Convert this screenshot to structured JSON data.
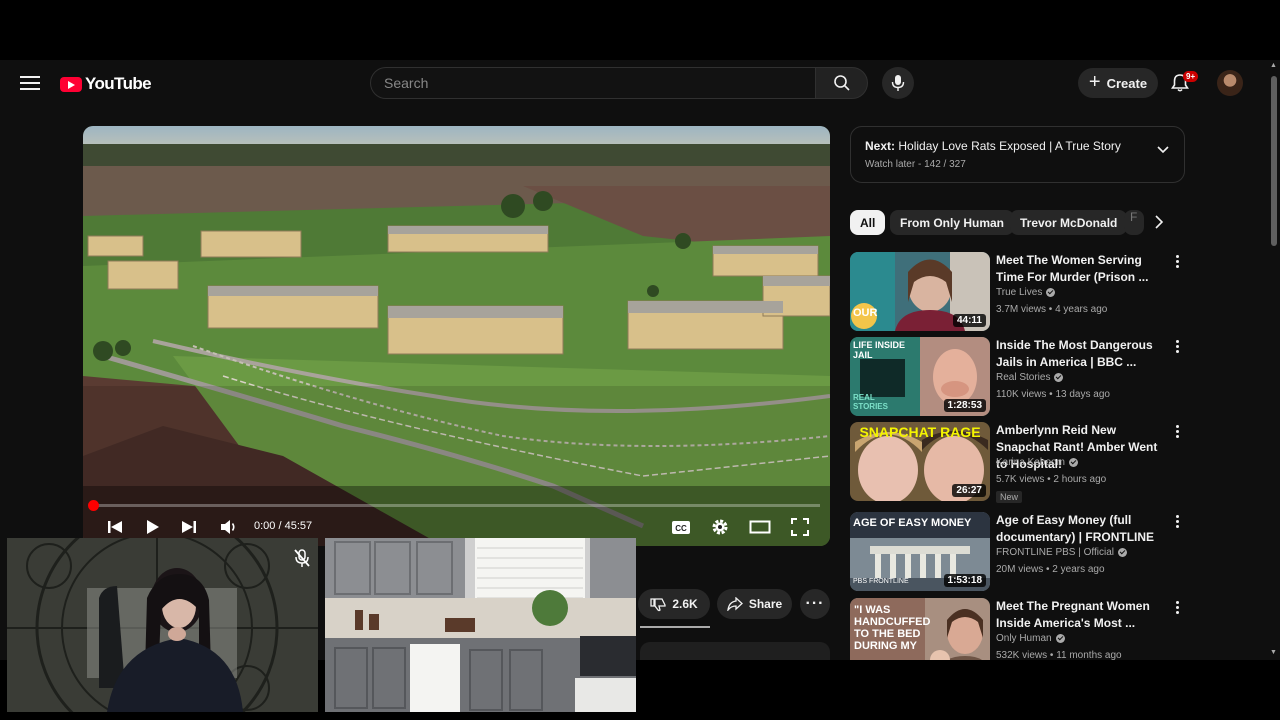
{
  "header": {
    "logo_text": "YouTube",
    "search_placeholder": "Search",
    "create_label": "Create",
    "notification_count": "9+"
  },
  "player": {
    "time_display": "0:00 / 45:57",
    "progress_fraction": 0.0
  },
  "up_next": {
    "prefix": "Next:",
    "title": "Holiday Love Rats Exposed | A True Story",
    "playlist": "Watch later - 142 / 327"
  },
  "chips": [
    "All",
    "From Only Human",
    "Trevor McDonald",
    "F"
  ],
  "recommendations": [
    {
      "title": "Meet The Women Serving Time For Murder (Prison ...",
      "channel": "True Lives",
      "verified": true,
      "meta": "3.7M views • 4 years ago",
      "duration": "44:11",
      "thumb_text": "OUR"
    },
    {
      "title": "Inside The Most Dangerous Jails in America | BBC ...",
      "channel": "Real Stories",
      "verified": true,
      "meta": "110K views • 13 days ago",
      "duration": "1:28:53",
      "thumb_text": "LIFE INSIDE JAIL",
      "thumb_text2": "REAL STORIES"
    },
    {
      "title": "Amberlynn Reid New Snapchat Rant! Amber Went to Hospital!",
      "channel": "Karina Kaboom",
      "verified": true,
      "meta": "5.7K views • 2 hours ago",
      "badge": "New",
      "duration": "26:27",
      "thumb_text": "SNAPCHAT RAGE"
    },
    {
      "title": "Age of Easy Money (full documentary) | FRONTLINE",
      "channel": "FRONTLINE PBS | Official",
      "verified": true,
      "meta": "20M views • 2 years ago",
      "duration": "1:53:18",
      "thumb_text": "AGE OF EASY MONEY",
      "thumb_text2": "PBS FRONTLINE"
    },
    {
      "title": "Meet The Pregnant Women Inside America's Most ...",
      "channel": "Only Human",
      "verified": true,
      "meta": "532K views • 11 months ago",
      "duration": "",
      "thumb_text": "\"I WAS HANDCUFFED TO THE BED DURING MY"
    }
  ],
  "actions": {
    "dislike_count": "2.6K",
    "share_label": "Share"
  },
  "colors": {
    "background": "#0f0f0f",
    "accent_red": "#ff0033",
    "chip_bg": "#272727"
  }
}
